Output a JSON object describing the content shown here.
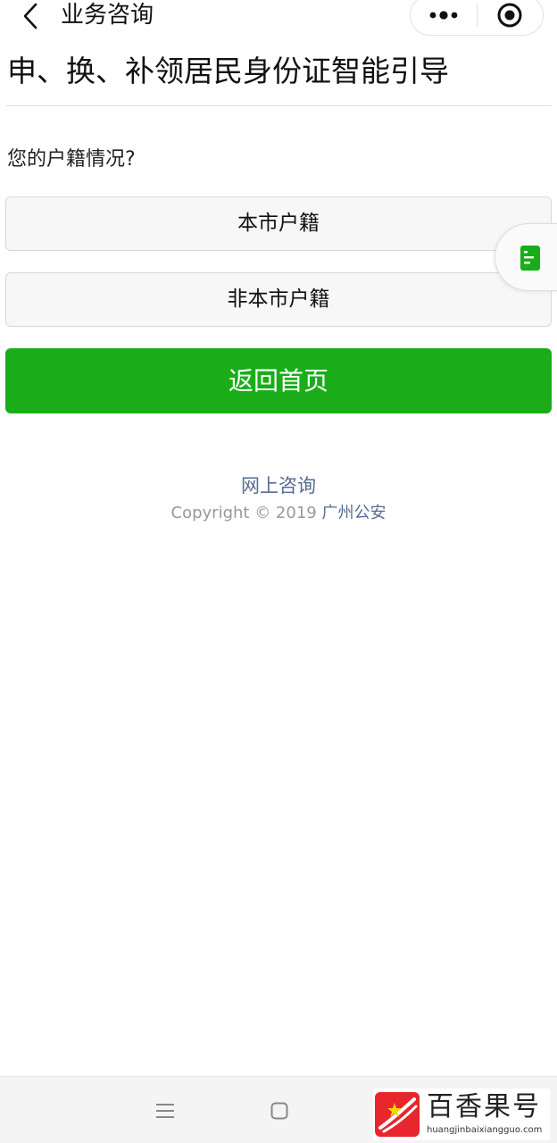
{
  "navbar": {
    "title": "业务咨询",
    "back_icon": "chevron-left-icon",
    "more_icon": "more-dots-icon",
    "close_icon": "capsule-close-icon"
  },
  "page": {
    "title": "申、换、补领居民身份证智能引导",
    "question": "您的户籍情况?",
    "options": [
      {
        "label": "本市户籍"
      },
      {
        "label": "非本市户籍"
      }
    ],
    "home_button": "返回首页"
  },
  "footer": {
    "consult_link": "网上咨询",
    "copyright_prefix": "Copyright © 2019",
    "copyright_org": "广州公安"
  },
  "side_float": {
    "icon": "document-icon"
  },
  "watermark": {
    "text": "百香果号",
    "url": "huangjinbaixiangguo.com"
  },
  "colors": {
    "primary_green": "#1aad19",
    "link_blue": "#576b95",
    "copyright_gray": "#999999",
    "watermark_red": "#e8262d"
  }
}
